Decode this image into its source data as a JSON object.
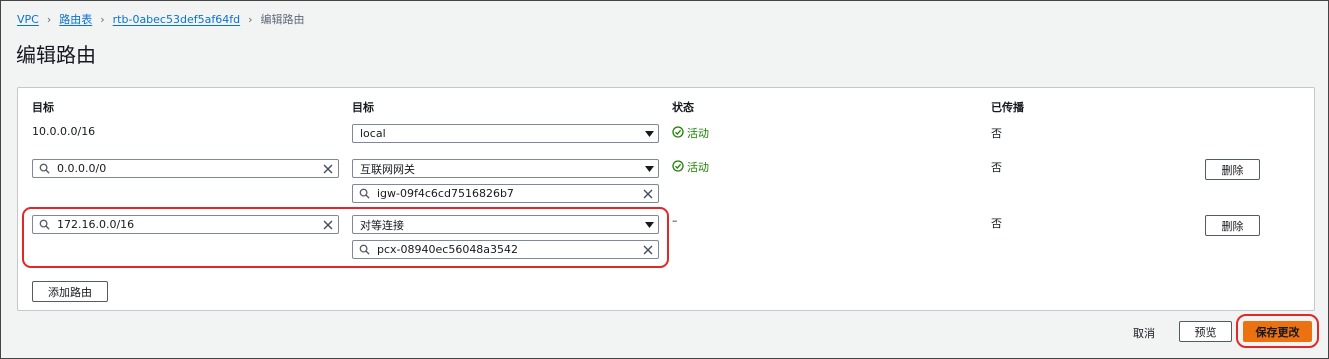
{
  "breadcrumb": {
    "items": [
      "VPC",
      "路由表",
      "rtb-0abec53def5af64fd"
    ],
    "current": "编辑路由"
  },
  "page_title": "编辑路由",
  "table": {
    "headers": [
      "目标",
      "目标",
      "状态",
      "已传播"
    ],
    "rows": [
      {
        "destination": "10.0.0.0/16",
        "target_type": "local",
        "target_id": "",
        "status": "活动",
        "propagated": "否"
      },
      {
        "destination": "0.0.0.0/0",
        "target_type": "互联网网关",
        "target_id": "igw-09f4c6cd7516826b7",
        "status": "活动",
        "propagated": "否",
        "remove_label": "删除"
      },
      {
        "destination": "172.16.0.0/16",
        "target_type": "对等连接",
        "target_id": "pcx-08940ec56048a3542",
        "status": "–",
        "propagated": "否",
        "remove_label": "删除"
      }
    ]
  },
  "add_route_label": "添加路由",
  "footer": {
    "cancel": "取消",
    "preview": "预览",
    "save": "保存更改"
  },
  "colors": {
    "accent": "#ec7211",
    "link": "#0972d3",
    "success": "#1d8102",
    "highlight_ring": "#e02828"
  },
  "icons": [
    "chevron-right-icon",
    "search-icon",
    "clear-icon",
    "caret-down-icon",
    "check-circle-icon"
  ]
}
